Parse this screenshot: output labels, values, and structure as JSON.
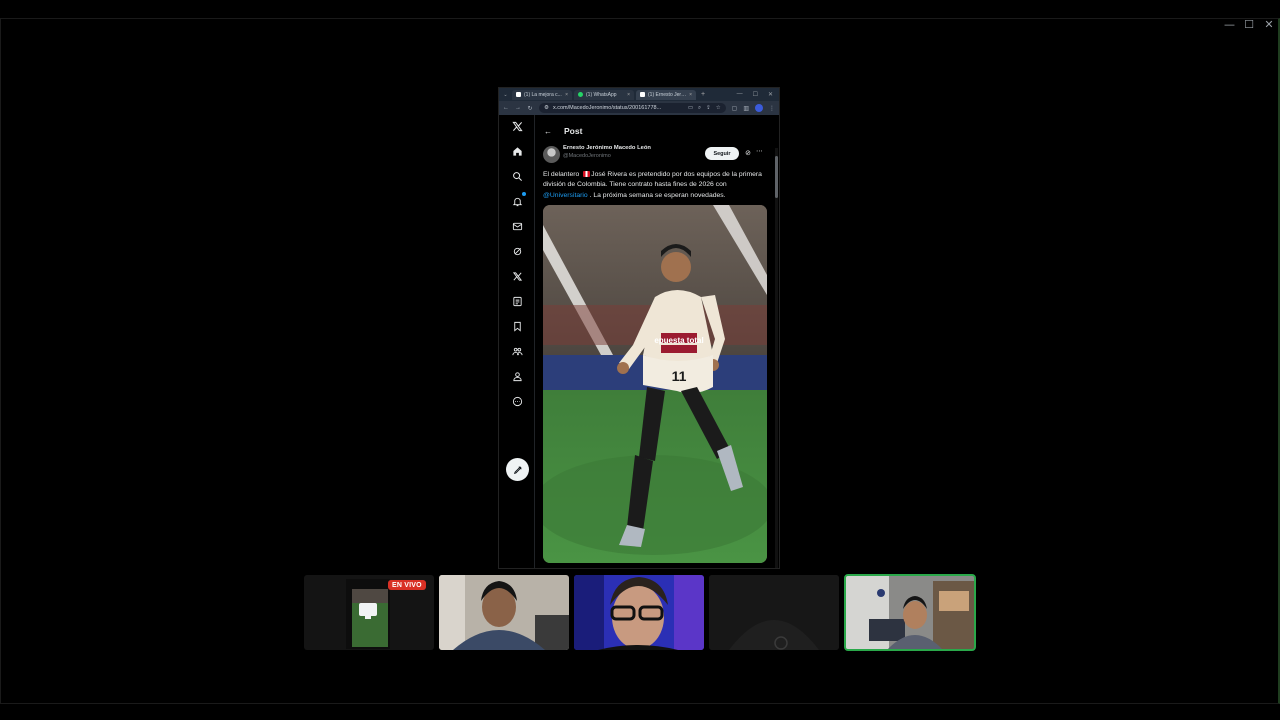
{
  "window": {
    "title": "",
    "controls": [
      "—",
      "☐",
      "✕"
    ]
  },
  "browser": {
    "tabs": [
      {
        "label": "(1) La mejora c...",
        "icon": "x-logo-icon",
        "active": false
      },
      {
        "label": "(1) WhatsApp",
        "icon": "whatsapp-icon",
        "active": false
      },
      {
        "label": "(1) Ernesto Jerónimo",
        "icon": "x-logo-icon",
        "active": true
      }
    ],
    "new_tab": "+",
    "url": "x.com/MacedoJeronimo/status/200161778..."
  },
  "x": {
    "nav_icons": [
      "x-logo-icon",
      "home-icon",
      "search-icon",
      "notifications-icon",
      "messages-icon",
      "grok-icon",
      "premium-icon",
      "lists-icon",
      "bookmarks-icon",
      "communities-icon",
      "profile-icon",
      "more-icon"
    ],
    "post_header": "Post",
    "author": {
      "name": "Ernesto Jerónimo Macedo León",
      "handle": "@MacedoJeronimo"
    },
    "follow_label": "Seguir",
    "tweet": {
      "part1": "El delantero ",
      "part2": "José Rivera es pretendido por dos equipos de la primera división de Colombia. Tiene contrato hasta fines de 2026 con ",
      "mention": "@Universitario",
      "part3": " . La próxima semana se esperan novedades."
    },
    "photo": {
      "jersey_text": "epuesta total",
      "number": "11"
    }
  },
  "participants": [
    {
      "type": "screen-share",
      "badge": "EN VIVO"
    },
    {
      "type": "camera"
    },
    {
      "type": "camera"
    },
    {
      "type": "camera"
    },
    {
      "type": "camera",
      "highlighted": true
    }
  ],
  "colors": {
    "accent_blue": "#1d9bf0",
    "live_red": "#d93025",
    "speaker_green": "#2aa84a"
  }
}
